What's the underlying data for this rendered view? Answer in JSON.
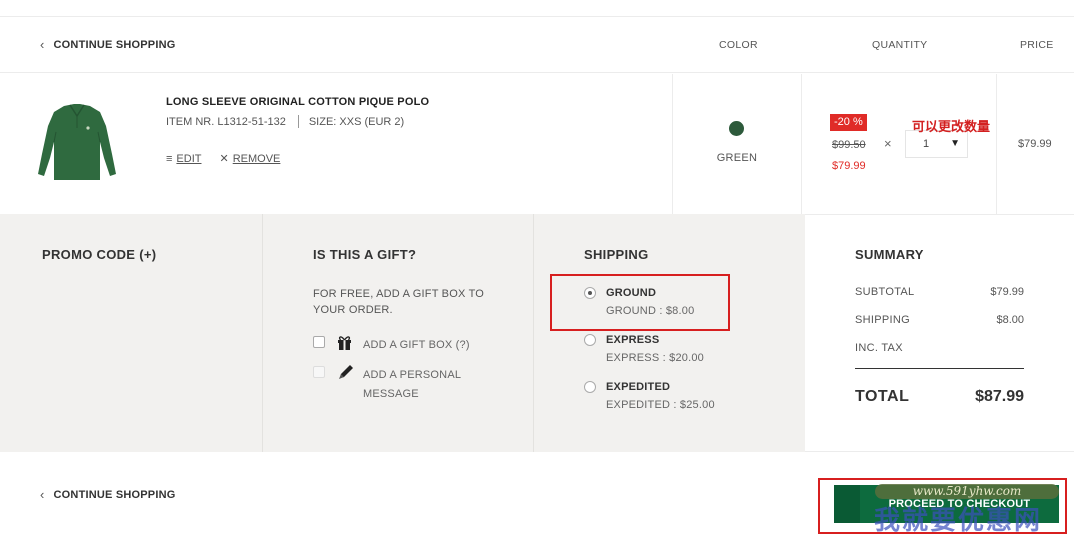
{
  "header": {
    "continue_label": "CONTINUE SHOPPING",
    "col_color": "COLOR",
    "col_quantity": "QUANTITY",
    "col_price": "PRICE"
  },
  "product": {
    "name": "LONG SLEEVE ORIGINAL COTTON PIQUE POLO",
    "item_nr": "ITEM NR. L1312-51-132",
    "size": "SIZE: XXS (EUR 2)",
    "edit_label": "EDIT",
    "remove_label": "REMOVE",
    "color_name": "GREEN",
    "color_hex": "#2d5a3b",
    "discount": "-20 %",
    "original_price": "$99.50",
    "sale_price": "$79.99",
    "quantity": "1",
    "annotation": "可以更改数量",
    "line_price": "$79.99"
  },
  "promo": {
    "title": "PROMO CODE (+)"
  },
  "gift": {
    "title": "IS THIS A GIFT?",
    "text": "FOR FREE, ADD A GIFT BOX TO YOUR ORDER.",
    "gift_box_label": "ADD A GIFT BOX (?)",
    "message_label": "ADD A PERSONAL MESSAGE"
  },
  "shipping": {
    "title": "SHIPPING",
    "options": [
      {
        "name": "GROUND",
        "detail": "GROUND : $8.00",
        "selected": true
      },
      {
        "name": "EXPRESS",
        "detail": "EXPRESS : $20.00",
        "selected": false
      },
      {
        "name": "EXPEDITED",
        "detail": "EXPEDITED : $25.00",
        "selected": false
      }
    ]
  },
  "summary": {
    "title": "SUMMARY",
    "subtotal_label": "SUBTOTAL",
    "subtotal_value": "$79.99",
    "shipping_label": "SHIPPING",
    "shipping_value": "$8.00",
    "tax_label": "INC. TAX",
    "total_label": "TOTAL",
    "total_value": "$87.99"
  },
  "footer": {
    "continue_label": "CONTINUE SHOPPING",
    "checkout_label": "PROCEED TO CHECKOUT"
  },
  "watermark": {
    "url": "www.591yhw.com",
    "cn": "我就要优惠网"
  },
  "colors": {
    "accent_red": "#e02b27",
    "checkout_green": "#0d6b3e",
    "annotation_red": "#d71f1f"
  }
}
